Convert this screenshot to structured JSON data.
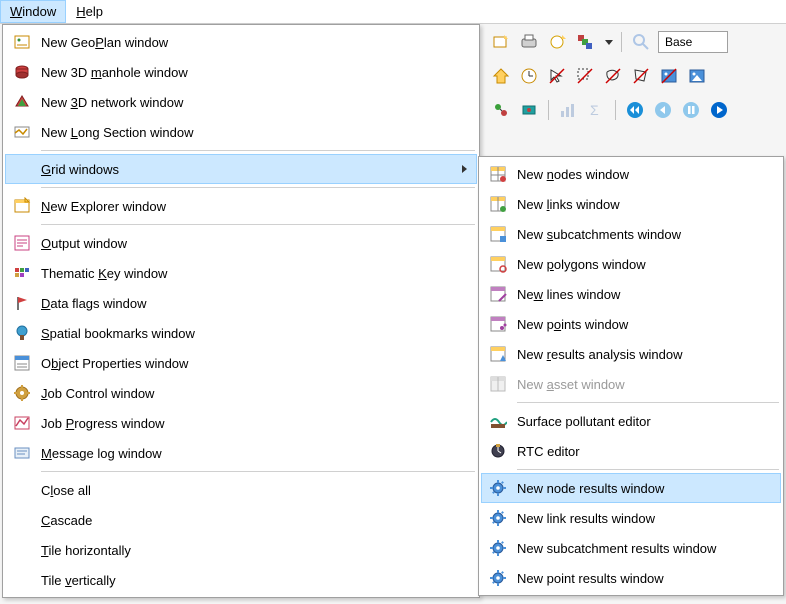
{
  "menubar": {
    "window": "Window",
    "help": "Help"
  },
  "toolbar": {
    "base_label": "Base"
  },
  "main_menu": [
    {
      "label": "New GeoPlan window",
      "underline": "P",
      "icon": "geoplan"
    },
    {
      "label": "New 3D manhole window",
      "underline": "m",
      "icon": "manhole3d"
    },
    {
      "label": "New 3D network window",
      "underline": "3",
      "icon": "network3d"
    },
    {
      "label": "New Long Section window",
      "underline": "L",
      "icon": "longsection"
    },
    {
      "sep": true
    },
    {
      "label": "Grid windows",
      "underline": "G",
      "icon": "",
      "highlight": true,
      "submenu": true
    },
    {
      "sep": true
    },
    {
      "label": "New Explorer window",
      "underline": "N",
      "icon": "explorer"
    },
    {
      "sep": true
    },
    {
      "label": "Output window",
      "underline": "O",
      "icon": "output"
    },
    {
      "label": "Thematic Key window",
      "underline": "K",
      "icon": "thematic"
    },
    {
      "label": "Data flags window",
      "underline": "D",
      "icon": "flags"
    },
    {
      "label": "Spatial bookmarks window",
      "underline": "S",
      "icon": "bookmarks"
    },
    {
      "label": "Object Properties window",
      "underline": "b",
      "icon": "properties"
    },
    {
      "label": "Job Control window",
      "underline": "J",
      "icon": "jobcontrol"
    },
    {
      "label": "Job Progress window",
      "underline": "P",
      "icon": "progress"
    },
    {
      "label": "Message log window",
      "underline": "M",
      "icon": "messagelog"
    },
    {
      "sep": true
    },
    {
      "label": "Close all",
      "underline": "l",
      "icon": ""
    },
    {
      "label": "Cascade",
      "underline": "C",
      "icon": ""
    },
    {
      "label": "Tile horizontally",
      "underline": "T",
      "icon": ""
    },
    {
      "label": "Tile vertically",
      "underline": "v",
      "icon": ""
    }
  ],
  "sub_menu": [
    {
      "label": "New nodes window",
      "underline": "n",
      "icon": "grid-yellow"
    },
    {
      "label": "New links window",
      "underline": "l",
      "icon": "grid-green"
    },
    {
      "label": "New subcatchments window",
      "underline": "s",
      "icon": "grid-blue"
    },
    {
      "label": "New polygons window",
      "underline": "p",
      "icon": "grid-circle"
    },
    {
      "label": "New lines window",
      "underline": "w",
      "icon": "grid-lines"
    },
    {
      "label": "New points window",
      "underline": "o",
      "icon": "grid-points"
    },
    {
      "label": "New results analysis window",
      "underline": "r",
      "icon": "grid-results"
    },
    {
      "label": "New asset window",
      "underline": "a",
      "icon": "grid-asset",
      "disabled": true
    },
    {
      "sep": true
    },
    {
      "label": "Surface pollutant editor",
      "underline": "",
      "icon": "surface"
    },
    {
      "label": "RTC editor",
      "underline": "",
      "icon": "rtc"
    },
    {
      "sep": true
    },
    {
      "label": "New node results window",
      "underline": "",
      "icon": "gear-blue",
      "highlight": true
    },
    {
      "label": "New link results window",
      "underline": "",
      "icon": "gear-blue"
    },
    {
      "label": "New subcatchment results window",
      "underline": "",
      "icon": "gear-blue"
    },
    {
      "label": "New point results window",
      "underline": "",
      "icon": "gear-blue"
    }
  ]
}
